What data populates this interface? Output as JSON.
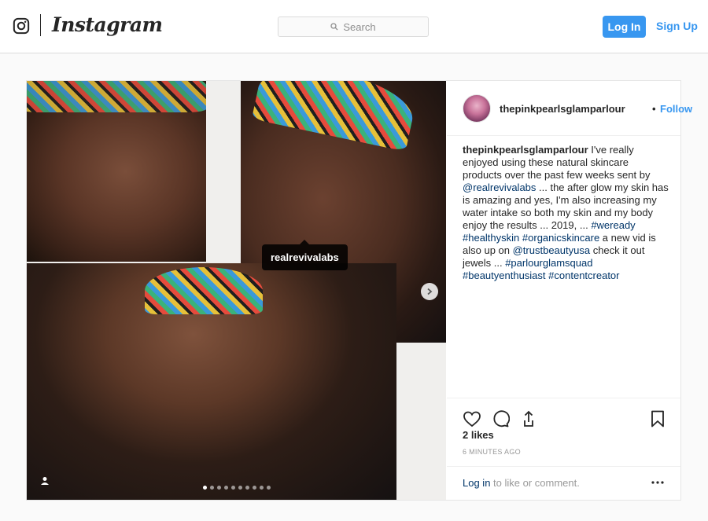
{
  "header": {
    "brand": "Instagram",
    "search_placeholder": "Search",
    "login_label": "Log In",
    "signup_label": "Sign Up"
  },
  "post": {
    "username": "thepinkpearlsglamparlour",
    "separator": "•",
    "follow_label": "Follow",
    "tag_label": "realrevivalabs",
    "carousel": {
      "slide_count": 10,
      "active_index": 0
    },
    "caption": {
      "username": "thepinkpearlsglamparlour",
      "t1": " I've really enjoyed using these natural skincare products over the past few weeks sent by ",
      "mention1": "@realrevivalabs",
      "t2": " ... the after glow my skin has is amazing and yes, I'm also increasing my water intake so both my skin and my body enjoy the results ... 2019, ... ",
      "tag1": "#weready",
      "sp1": " ",
      "tag2": "#healthyskin",
      "sp2": " ",
      "tag3": "#organicskincare",
      "t3": " a new vid is also up on ",
      "mention2": "@trustbeautyusa",
      "t4": " check it out jewels ... ",
      "tag4": "#parlourglamsquad",
      "sp3": " ",
      "tag5": "#beautyenthusiast",
      "sp4": " ",
      "tag6": "#contentcreator"
    },
    "likes": "2 likes",
    "time_ago": "6 MINUTES AGO",
    "login_link": "Log in",
    "login_suffix": " to like or comment."
  },
  "icons": [
    "instagram-glyph-icon",
    "search-icon",
    "chevron-right-icon",
    "user-tag-icon",
    "heart-icon",
    "comment-icon",
    "share-icon",
    "bookmark-icon",
    "more-options-icon"
  ],
  "colors": {
    "accent": "#3897f0",
    "link": "#003569",
    "muted": "#999999",
    "text": "#262626"
  }
}
